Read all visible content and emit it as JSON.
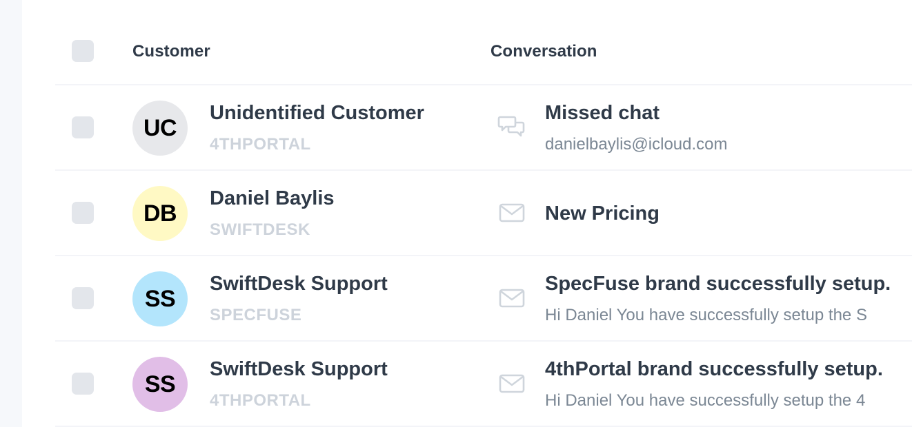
{
  "table": {
    "columns": {
      "customer": "Customer",
      "conversation": "Conversation"
    },
    "rows": [
      {
        "initials": "UC",
        "avatar_color": "#e7e8eb",
        "name": "Unidentified Customer",
        "brand": "4THPORTAL",
        "channel_icon": "chat-bubbles-icon",
        "title": "Missed chat",
        "subtitle": "danielbaylis@icloud.com"
      },
      {
        "initials": "DB",
        "avatar_color": "#fff9c4",
        "name": "Daniel Baylis",
        "brand": "SWIFTDESK",
        "channel_icon": "envelope-icon",
        "title": "New Pricing",
        "subtitle": ""
      },
      {
        "initials": "SS",
        "avatar_color": "#b3e5fc",
        "name": "SwiftDesk Support",
        "brand": "SPECFUSE",
        "channel_icon": "envelope-icon",
        "title": "SpecFuse brand successfully setup.",
        "subtitle": "Hi Daniel You have successfully setup the S"
      },
      {
        "initials": "SS",
        "avatar_color": "#e1bee7",
        "name": "SwiftDesk Support",
        "brand": "4THPORTAL",
        "channel_icon": "envelope-icon",
        "title": "4thPortal brand successfully setup.",
        "subtitle": "Hi Daniel You have successfully setup the 4"
      }
    ]
  },
  "colors": {
    "heading": "#2f3a48",
    "brand_text": "#cdd3db",
    "subtitle_text": "#7b8794",
    "checkbox": "#e3e6eb",
    "icon": "#cfd5dc",
    "divider": "#f3f4f8",
    "left_strip": "#f6f8fb"
  }
}
